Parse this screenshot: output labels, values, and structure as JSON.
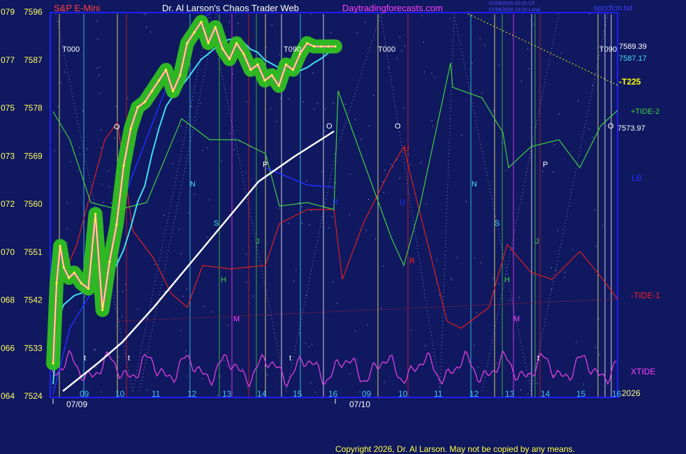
{
  "header": {
    "instrument": "S&P E-Mini",
    "author": "Dr. Al Larson's Chaos Trader Web",
    "site": "Daytradingforecasts.com",
    "timestamp_line1": "07/09/2026 20:20 UT",
    "timestamp_line2": "07/09/2026 13:20 Local",
    "file": "spccfcm.txt"
  },
  "footer": {
    "copyright": "Copyright 2026, Dr. Al Larson. May not be copied by any means."
  },
  "colors": {
    "background": "#101860",
    "frame": "#2020ff",
    "price": "#ffff40",
    "glow": "#30c020",
    "magenta": "#ff40ff",
    "cyan": "#40e0f0",
    "white": "#ffffff",
    "green_tide": "#40d040",
    "red_tide": "#e02020",
    "blue_line": "#2030ff",
    "xtide": "#e040e0"
  },
  "chart_data": {
    "type": "line",
    "title": "S&P E-Mini",
    "y_axis": {
      "labels": [
        {
          "pts": "079",
          "price": "7596"
        },
        {
          "pts": "077",
          "price": "7587"
        },
        {
          "pts": "075",
          "price": "7578"
        },
        {
          "pts": "073",
          "price": "7569"
        },
        {
          "pts": "072",
          "price": "7560"
        },
        {
          "pts": "070",
          "price": "7551"
        },
        {
          "pts": "068",
          "price": "7542"
        },
        {
          "pts": "066",
          "price": "7533"
        },
        {
          "pts": "064",
          "price": "7524"
        }
      ],
      "ylim": [
        7524,
        7596
      ]
    },
    "x_axis": {
      "hour_ticks": [
        "09",
        "10",
        "11",
        "12",
        "13",
        "14",
        "15",
        "16",
        "09",
        "10",
        "11",
        "12",
        "13",
        "14",
        "15",
        "16"
      ],
      "dates": [
        "07/09",
        "07/10"
      ]
    },
    "right_labels": {
      "last_price": "7589.39",
      "ma_value": "7587.17",
      "t225": "-T225",
      "tide2": "+TIDE-2",
      "white_value": "7573.97",
      "lb": "LB",
      "tide1": "-TIDE-1",
      "xtide": "XTIDE",
      "year": "2026"
    },
    "cycle_labels": [
      "T000",
      "T090",
      "T000",
      "T090"
    ],
    "letter_markers": [
      "O",
      "N",
      "S",
      "H",
      "M",
      "P",
      "J",
      "O",
      "O",
      "U",
      "R",
      "N",
      "S",
      "H",
      "M",
      "P",
      "J",
      "O",
      "t",
      "t",
      "t",
      "t",
      "U",
      "R"
    ],
    "series": [
      {
        "name": "S&P E-Mini",
        "x": [
          0,
          0.1,
          0.2,
          0.3,
          0.45,
          0.6,
          0.8,
          1.0,
          1.2,
          1.4,
          1.6,
          1.8,
          2.0,
          2.2,
          2.4,
          2.6,
          2.8,
          3.0,
          3.2,
          3.4,
          3.6,
          3.8,
          4.0,
          4.2,
          4.4,
          4.6,
          4.8,
          5.0,
          5.2,
          5.4,
          5.6,
          5.8,
          6.0,
          6.2,
          6.4,
          6.6,
          6.8,
          7.0,
          7.2,
          7.4,
          7.6,
          7.8,
          8.0
        ],
        "y": [
          7530,
          7545,
          7552,
          7548,
          7546,
          7547,
          7545,
          7544,
          7558,
          7540,
          7549,
          7556,
          7567,
          7574,
          7578,
          7579,
          7581,
          7583,
          7585,
          7581,
          7584,
          7590,
          7592,
          7594,
          7590,
          7593,
          7589,
          7587,
          7590,
          7588,
          7585,
          7586,
          7583,
          7584,
          7582,
          7586,
          7585,
          7588,
          7590,
          7589.39,
          7589.39,
          7589.39,
          7589.39
        ]
      }
    ]
  }
}
